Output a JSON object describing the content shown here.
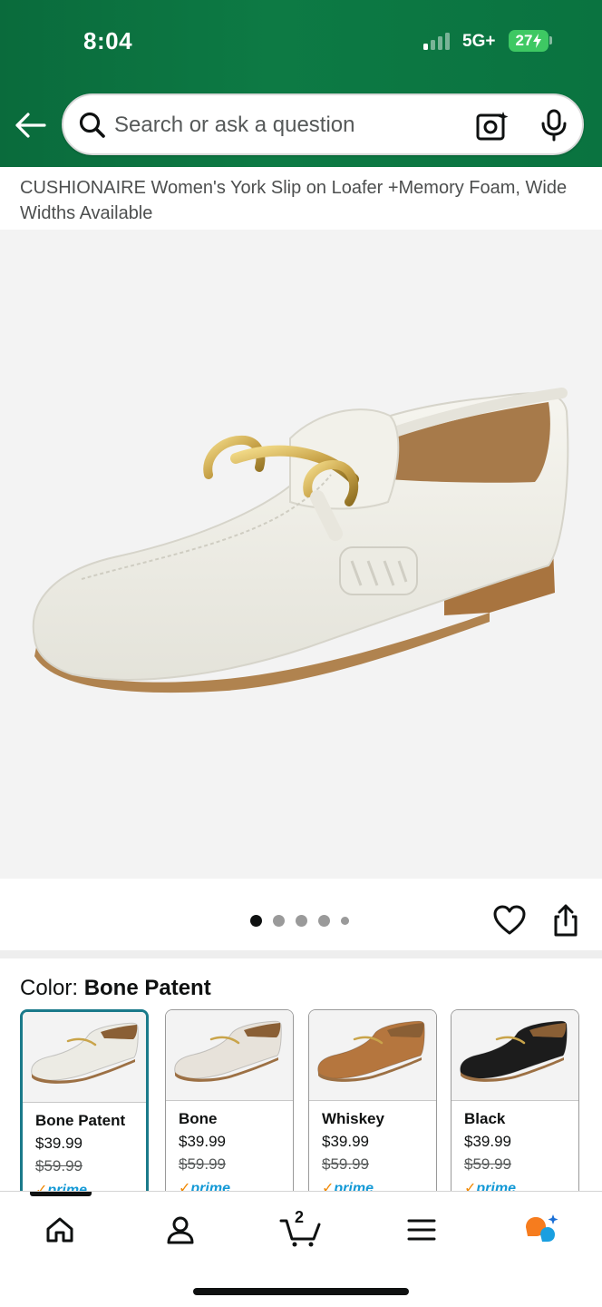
{
  "status_bar": {
    "time": "8:04",
    "network": "5G+",
    "battery": "27"
  },
  "header": {
    "search_placeholder": "Search or ask a question",
    "brand_color": "#0a6b3c"
  },
  "product": {
    "title": "CUSHIONAIRE Women's York Slip on Loafer +Memory Foam, Wide Widths Available",
    "image_pages": 5,
    "current_page": 1
  },
  "color": {
    "label": "Color: ",
    "selected": "Bone Patent"
  },
  "swatches": [
    {
      "name": "Bone Patent",
      "price": "$39.99",
      "list_price": "$59.99",
      "prime": "prime",
      "shoe_color": "#ecebe4",
      "selected": true
    },
    {
      "name": "Bone",
      "price": "$39.99",
      "list_price": "$59.99",
      "prime": "prime",
      "shoe_color": "#e7e2da",
      "selected": false
    },
    {
      "name": "Whiskey",
      "price": "$39.99",
      "list_price": "$59.99",
      "prime": "prime",
      "shoe_color": "#b5763e",
      "selected": false
    },
    {
      "name": "Black",
      "price": "$39.99",
      "list_price": "$59.99",
      "prime": "prime",
      "shoe_color": "#1c1c1c",
      "selected": false
    }
  ],
  "bottom_nav": {
    "cart_count": "2",
    "items": [
      "home-icon",
      "account-icon",
      "cart-icon",
      "menu-icon",
      "rufus-icon"
    ]
  }
}
